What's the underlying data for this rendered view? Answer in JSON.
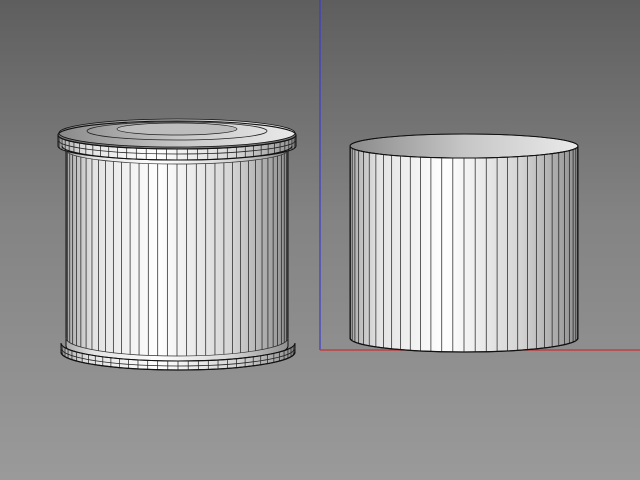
{
  "viewport": {
    "view_mode": "shaded-wireframe",
    "background_top": "#5e5e5e",
    "background_bottom": "#9a9a9a"
  },
  "axes": {
    "x_axis_color": "#c83232",
    "y_axis_color": "#3c3cc8"
  },
  "objects": [
    {
      "name": "detailed-can-body",
      "shape": "cylinder",
      "lip_rings": "top-and-bottom",
      "segments": 72
    },
    {
      "name": "plain-cylinder",
      "shape": "cylinder",
      "lip_rings": "none",
      "segments": 64
    }
  ]
}
